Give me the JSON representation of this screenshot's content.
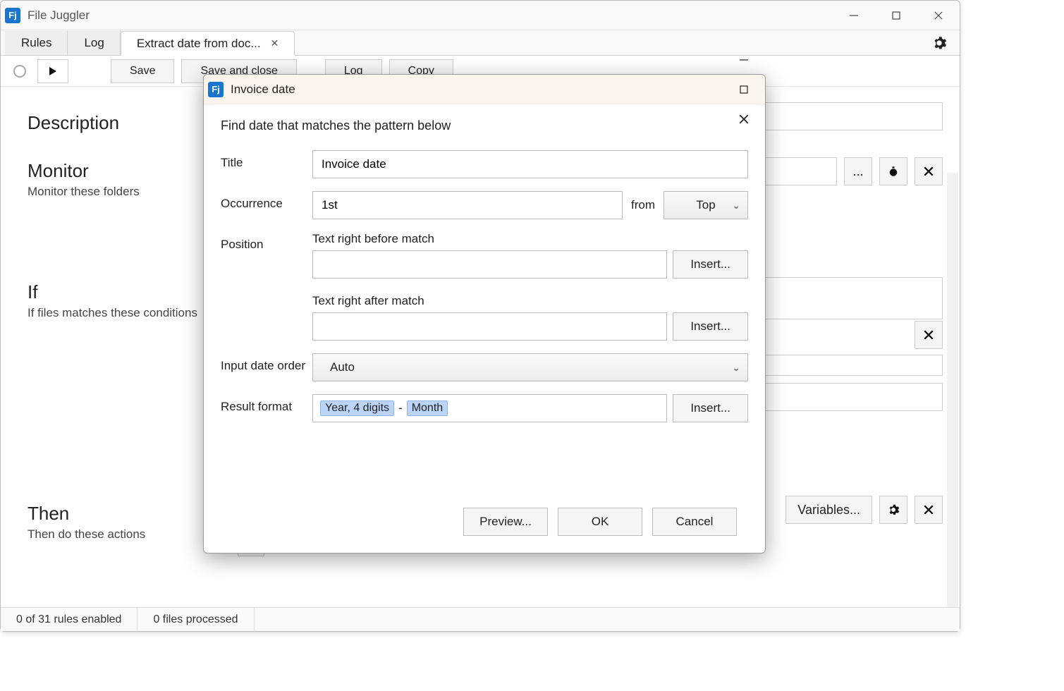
{
  "window": {
    "title": "File Juggler",
    "app_icon_text": "Fj"
  },
  "tabs": {
    "rules": "Rules",
    "log": "Log",
    "active": "Extract date from doc..."
  },
  "toolbar": {
    "save": "Save",
    "save_and_close": "Save and close",
    "log": "Log",
    "copy": "Copy"
  },
  "sections": {
    "description": "Description",
    "monitor": "Monitor",
    "monitor_sub": "Monitor these folders",
    "if": "If",
    "if_sub": "If files matches these conditions",
    "then": "Then",
    "then_sub": "Then do these actions"
  },
  "right_panel": {
    "browse": "...",
    "variables": "Variables..."
  },
  "dialog": {
    "title": "Invoice date",
    "subtitle": "Find date that matches the pattern below",
    "labels": {
      "title": "Title",
      "occurrence": "Occurrence",
      "from": "from",
      "position": "Position",
      "text_before": "Text right before match",
      "text_after": "Text right after match",
      "input_order": "Input date order",
      "result_format": "Result format"
    },
    "fields": {
      "title_value": "Invoice date",
      "occurrence_value": "1st",
      "from_value": "Top",
      "before_value": "",
      "after_value": "",
      "input_order_value": "Auto"
    },
    "result_chips": {
      "year": "Year, 4 digits",
      "sep": "-",
      "month": "Month"
    },
    "insert": "Insert...",
    "buttons": {
      "preview": "Preview...",
      "ok": "OK",
      "cancel": "Cancel"
    }
  },
  "status": {
    "rules": "0 of 31 rules enabled",
    "files": "0 files processed"
  }
}
